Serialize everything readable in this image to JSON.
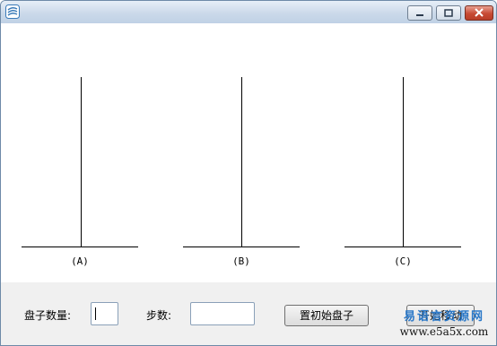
{
  "window": {
    "title": ""
  },
  "pegs": [
    {
      "label": "(A)"
    },
    {
      "label": "(B)"
    },
    {
      "label": "(C)"
    }
  ],
  "controls": {
    "disk_count_label": "盘子数量:",
    "disk_count_value": "",
    "steps_label": "步数:",
    "steps_value": "",
    "reset_button": "置初始盘子",
    "start_button": "开始移动"
  },
  "watermark": {
    "line1": "易语言资源网",
    "line2": "www.e5a5x.com"
  }
}
